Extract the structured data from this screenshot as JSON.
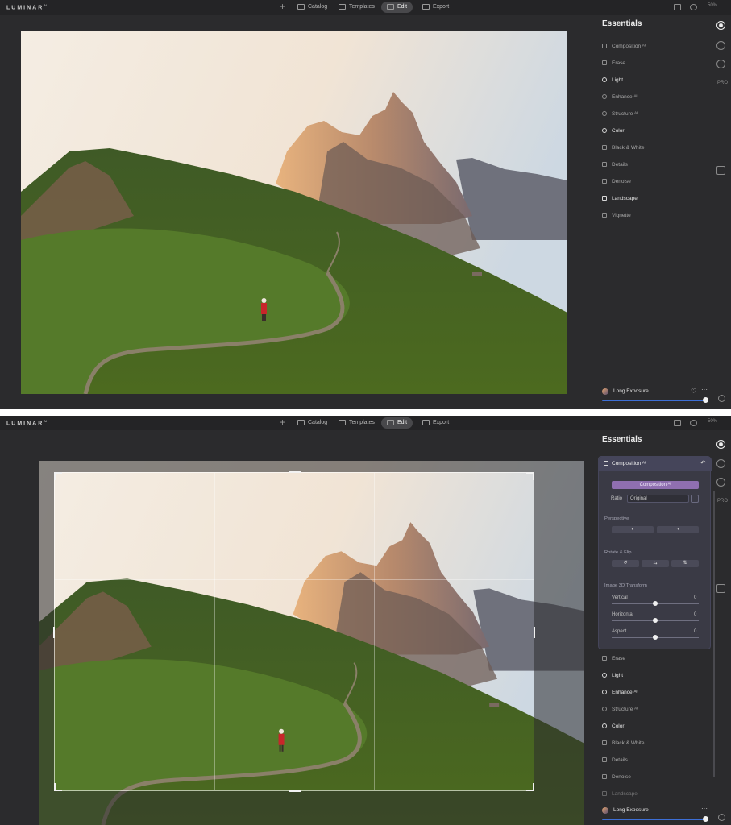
{
  "app": {
    "logo": "LUMINAR",
    "logo_sup": "AI",
    "zoom": "50%"
  },
  "nav": {
    "plus": "+",
    "tabs": [
      "Catalog",
      "Templates",
      "Edit",
      "Export"
    ],
    "active_tab": "Edit"
  },
  "panel": {
    "title": "Essentials",
    "tools_top": [
      "Composition ᴬᴵ",
      "Erase",
      "Light",
      "Enhance ᴬᴵ",
      "Structure ᴬᴵ",
      "Color",
      "Black & White",
      "Details",
      "Denoise",
      "Landscape",
      "Vignette"
    ],
    "tools_bottom": [
      "Erase",
      "Light",
      "Enhance ᴬᴵ",
      "Structure ᴬᴵ",
      "Color",
      "Black & White",
      "Details",
      "Denoise",
      "Landscape"
    ],
    "pro_label": "PRO",
    "preset": {
      "name": "Long Exposure",
      "heart": "♡",
      "more": "···",
      "amount": 1.0
    }
  },
  "composition": {
    "header": "Composition ᴬᴵ",
    "button": "Composition ᴬᴵ",
    "ratio_label": "Ratio",
    "ratio_value": "Original",
    "section_perspective": "Perspective",
    "section_rotate": "Rotate & Flip",
    "section_3d": "Image 3D Transform",
    "sliders": [
      {
        "label": "Vertical",
        "value": "0"
      },
      {
        "label": "Horizontal",
        "value": "0"
      },
      {
        "label": "Aspect",
        "value": "0"
      }
    ]
  },
  "colors": {
    "accent": "#3d6fd6",
    "composition_button": "#8f6fb0",
    "background": "#2b2b2d"
  }
}
